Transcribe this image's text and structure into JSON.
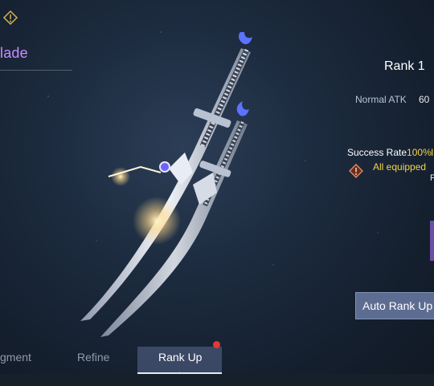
{
  "weapon": {
    "name": "lade"
  },
  "stats": {
    "rank_title": "Rank 1",
    "atk_label": "Normal ATK",
    "atk_value": "60"
  },
  "requirements": {
    "success_label": "Success Rate",
    "success_value": "100%",
    "success_trail": "I",
    "note": "All equipped",
    "note_trail": "F"
  },
  "buttons": {
    "auto_rank_up": "Auto Rank Up"
  },
  "tabs": [
    {
      "label": "gment"
    },
    {
      "label": "Refine"
    },
    {
      "label": "Rank Up",
      "active": true,
      "has_notification": true
    }
  ],
  "icons": [
    "gem-icon",
    "warning-diamond-icon",
    "chevron-up-icon"
  ],
  "colors": {
    "name_accent": "#c98cff",
    "highlight": "#f3d24a",
    "button_bg": "#5d6c91",
    "notification": "#e23a3a"
  }
}
